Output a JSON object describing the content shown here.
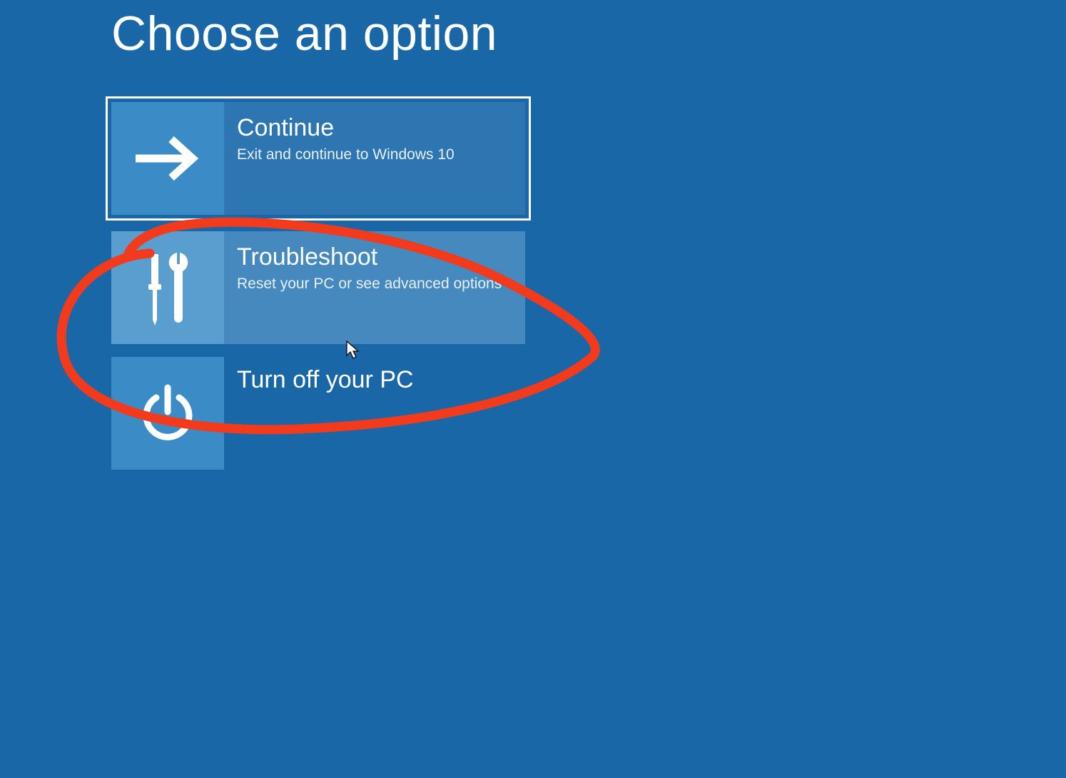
{
  "page": {
    "title": "Choose an option"
  },
  "options": {
    "continue": {
      "title": "Continue",
      "desc": "Exit and continue to Windows 10"
    },
    "troubleshoot": {
      "title": "Troubleshoot",
      "desc": "Reset your PC or see advanced options"
    },
    "poweroff": {
      "title": "Turn off your PC"
    }
  },
  "annotation": {
    "color": "#f23a1d"
  }
}
